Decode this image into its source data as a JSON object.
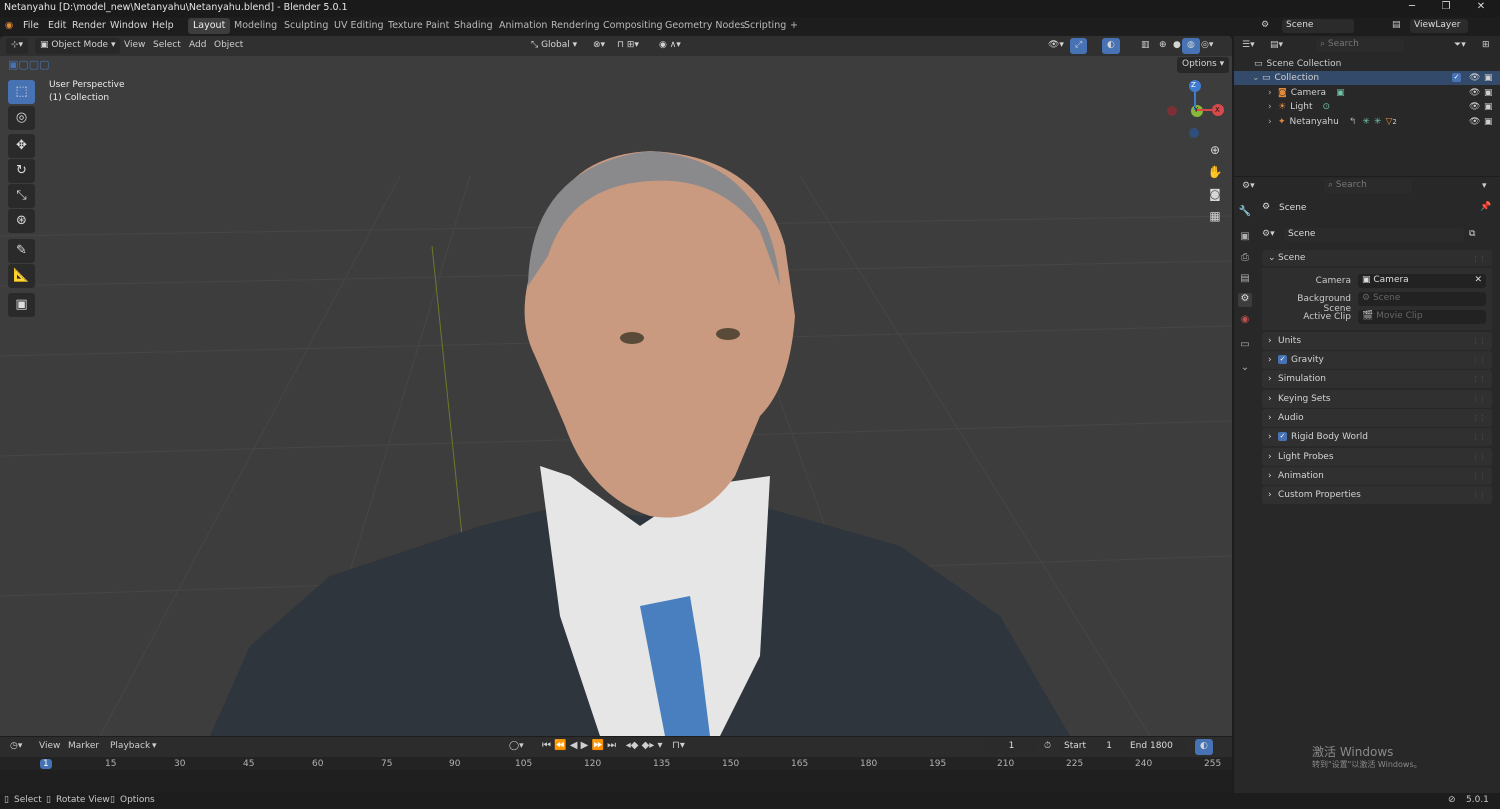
{
  "window": {
    "title": "Netanyahu [D:\\model_new\\Netanyahu\\Netanyahu.blend] - Blender 5.0.1",
    "min": "─",
    "max": "❐",
    "close": "✕"
  },
  "menu": [
    "File",
    "Edit",
    "Render",
    "Window",
    "Help"
  ],
  "workspaces": [
    "Layout",
    "Modeling",
    "Sculpting",
    "UV Editing",
    "Texture Paint",
    "Shading",
    "Animation",
    "Rendering",
    "Compositing",
    "Geometry Nodes",
    "Scripting"
  ],
  "workspace_add": "+",
  "top_right": {
    "scene": "Scene",
    "view_layer": "ViewLayer"
  },
  "viewport": {
    "mode": "Object Mode",
    "menus": [
      "View",
      "Select",
      "Add",
      "Object"
    ],
    "transform_orientation": "Global",
    "options": "Options",
    "overlay_line1": "User Perspective",
    "overlay_line2": "(1) Collection",
    "gizmo": {
      "z": "Z",
      "y": "Y",
      "x": "X"
    }
  },
  "outliner": {
    "search_placeholder": "Search",
    "root": "Scene Collection",
    "collection": "Collection",
    "items": [
      "Camera",
      "Light",
      "Netanyahu"
    ],
    "modifier_count": "2"
  },
  "properties": {
    "search_placeholder": "Search",
    "context": "Scene",
    "datablock": "Scene",
    "panel": "Scene",
    "fields": [
      {
        "label": "Camera",
        "value": "Camera"
      },
      {
        "label": "Background Scene",
        "value": "Scene"
      },
      {
        "label": "Active Clip",
        "value": "Movie Clip"
      }
    ],
    "subpanels": [
      "Units",
      "Gravity",
      "Simulation",
      "Keying Sets",
      "Audio",
      "Rigid Body World",
      "Light Probes",
      "Animation",
      "Custom Properties"
    ]
  },
  "timeline": {
    "menus": [
      "View",
      "Marker",
      "Playback"
    ],
    "current_frame": "1",
    "start_label": "Start",
    "start": "1",
    "end_label": "End",
    "end": "1800",
    "ticks": [
      "1",
      "15",
      "30",
      "45",
      "60",
      "75",
      "90",
      "105",
      "120",
      "135",
      "150",
      "165",
      "180",
      "195",
      "210",
      "225",
      "240",
      "255"
    ]
  },
  "statusbar": {
    "select": "Select",
    "rotate": "Rotate View",
    "options": "Options",
    "version": "5.0.1"
  },
  "watermark": {
    "line1": "激活 Windows",
    "line2": "转到\"设置\"以激活 Windows。"
  }
}
